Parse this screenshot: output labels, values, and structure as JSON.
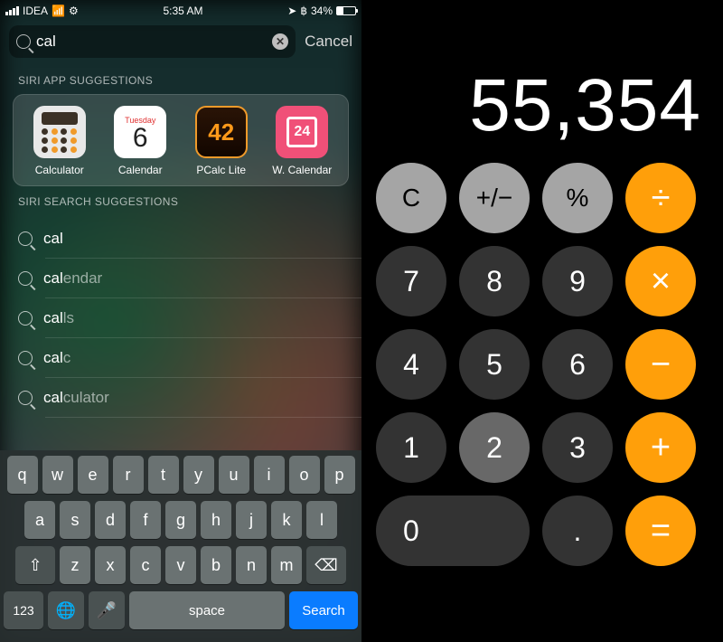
{
  "left": {
    "status": {
      "carrier": "IDEA",
      "time": "5:35 AM",
      "battery": "34%"
    },
    "search": {
      "value": "cal",
      "cancel": "Cancel"
    },
    "appSection": "SIRI APP SUGGESTIONS",
    "apps": [
      {
        "label": "Calculator"
      },
      {
        "label": "Calendar",
        "dow": "Tuesday",
        "day": "6"
      },
      {
        "label": "PCalc Lite",
        "num": "42"
      },
      {
        "label": "W. Calendar",
        "num": "24"
      }
    ],
    "suggSection": "SIRI SEARCH SUGGESTIONS",
    "sugg": [
      {
        "pre": "cal",
        "rest": ""
      },
      {
        "pre": "cal",
        "rest": "endar"
      },
      {
        "pre": "cal",
        "rest": "ls"
      },
      {
        "pre": "cal",
        "rest": "c"
      },
      {
        "pre": "cal",
        "rest": "culator"
      }
    ],
    "kb": {
      "r1": [
        "q",
        "w",
        "e",
        "r",
        "t",
        "y",
        "u",
        "i",
        "o",
        "p"
      ],
      "r2": [
        "a",
        "s",
        "d",
        "f",
        "g",
        "h",
        "j",
        "k",
        "l"
      ],
      "r3": [
        "z",
        "x",
        "c",
        "v",
        "b",
        "n",
        "m"
      ],
      "k123": "123",
      "space": "space",
      "search": "Search"
    }
  },
  "calc": {
    "display": "55,354",
    "keys": {
      "clear": "C",
      "sign": "+/−",
      "pct": "%",
      "div": "÷",
      "mul": "×",
      "sub": "−",
      "add": "+",
      "eq": "=",
      "d7": "7",
      "d8": "8",
      "d9": "9",
      "d4": "4",
      "d5": "5",
      "d6": "6",
      "d1": "1",
      "d2": "2",
      "d3": "3",
      "d0": "0",
      "dot": "."
    }
  }
}
